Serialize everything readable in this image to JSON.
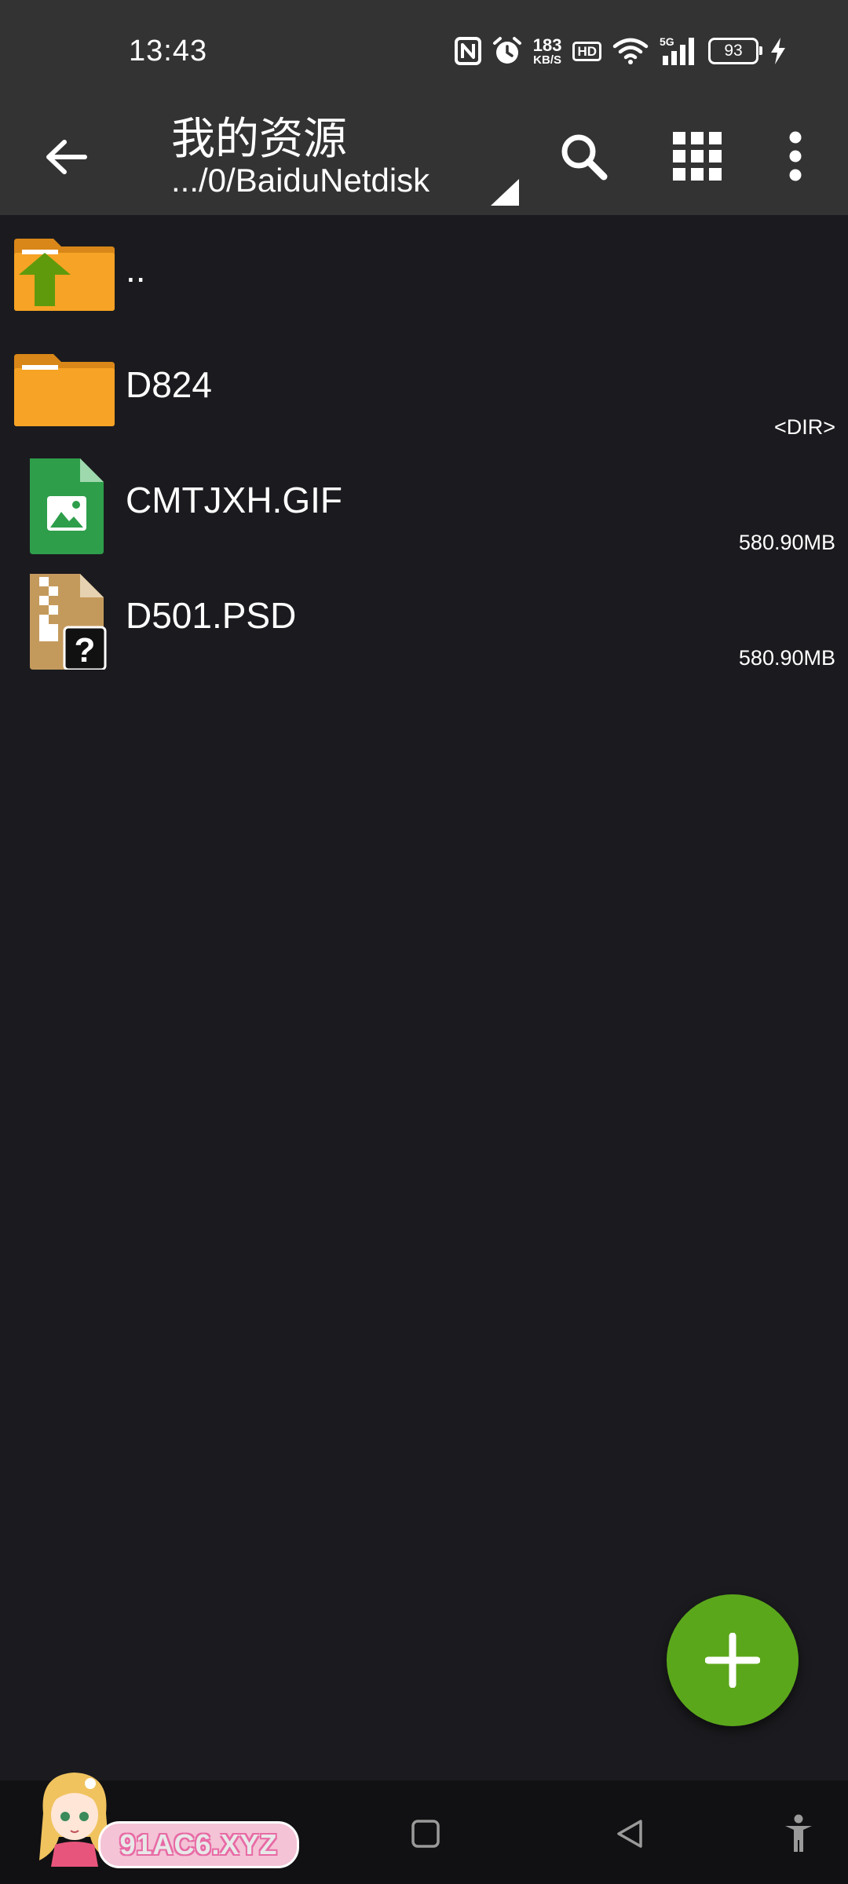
{
  "status_bar": {
    "time": "13:43",
    "net_speed_value": "183",
    "net_speed_unit": "KB/S",
    "hd_label": "HD",
    "network_label": "5G",
    "battery_level": "93",
    "icons": [
      "nfc-icon",
      "alarm-icon",
      "hd-icon",
      "wifi-icon",
      "cellular-signal-icon",
      "battery-icon",
      "charging-icon"
    ]
  },
  "toolbar": {
    "title": "我的资源",
    "path": ".../0/BaiduNetdisk",
    "icons": [
      "back-arrow-icon",
      "search-icon",
      "grid-view-icon",
      "more-vert-icon"
    ]
  },
  "files": [
    {
      "name": "..",
      "meta": "",
      "icon": "folder-up-icon"
    },
    {
      "name": "D824",
      "meta": "<DIR>",
      "icon": "folder-icon"
    },
    {
      "name": "CMTJXH.GIF",
      "meta": "580.90MB",
      "icon": "image-file-icon"
    },
    {
      "name": "D501.PSD",
      "meta": "580.90MB",
      "icon": "unknown-archive-file-icon"
    }
  ],
  "fab": {
    "icon": "plus-icon"
  },
  "nav_bar": {
    "icons": [
      "menu-icon",
      "home-square-icon",
      "back-triangle-icon",
      "accessibility-icon"
    ]
  },
  "watermark": {
    "text": "91AC6.XYZ"
  },
  "colors": {
    "bar_background": "#333333",
    "list_background": "#1b1b1f",
    "folder_orange": "#f7a325",
    "up_arrow_green": "#5f9a0d",
    "image_file_green": "#2e9e4b",
    "archive_tan": "#c49a5c",
    "fab_green": "#5ba71b"
  }
}
